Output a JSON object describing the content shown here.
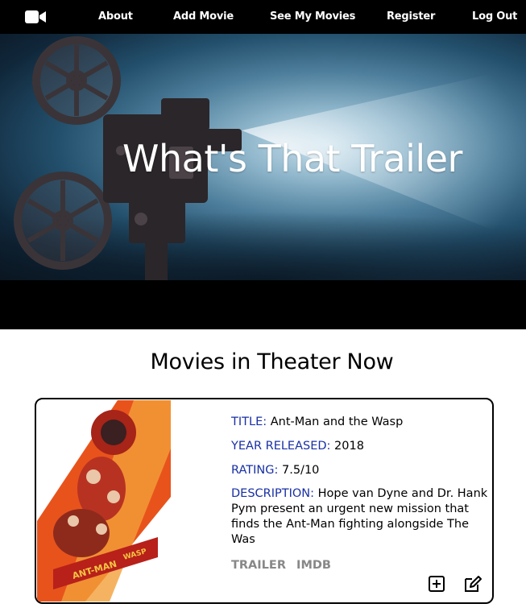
{
  "nav": {
    "logo_icon": "video-camera-icon",
    "items": [
      "About",
      "Add Movie",
      "See My Movies",
      "Register",
      "Log Out"
    ]
  },
  "hero": {
    "title": "What's That Trailer"
  },
  "section": {
    "title": "Movies in Theater Now"
  },
  "movie": {
    "title_label": "TITLE:",
    "title": "Ant-Man and the Wasp",
    "year_label": "YEAR RELEASED:",
    "year": "2018",
    "rating_label": "RATING:",
    "rating": "7.5/10",
    "description_label": "DESCRIPTION:",
    "description": "Hope van Dyne and Dr. Hank Pym present an urgent new mission that finds the Ant-Man fighting alongside The Was",
    "trailer_link": "TRAILER",
    "imdb_link": "IMDB",
    "poster_lettering": "ANT-MAN AND THE WASP",
    "add_icon": "plus-square-icon",
    "edit_icon": "edit-icon"
  },
  "colors": {
    "nav_bg": "#000000",
    "label_blue": "#1830a3",
    "link_gray": "#888888"
  }
}
